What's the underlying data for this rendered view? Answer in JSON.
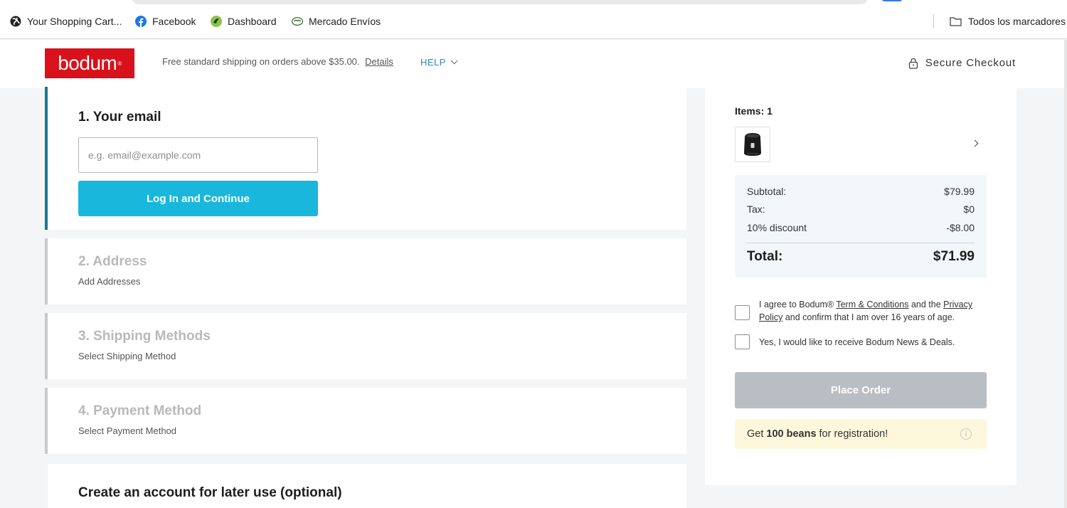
{
  "bookmarks": {
    "items": [
      {
        "label": "Your Shopping Cart...",
        "icon": "globe-icon"
      },
      {
        "label": "Facebook",
        "icon": "facebook-icon"
      },
      {
        "label": "Dashboard",
        "icon": "dashboard-icon"
      },
      {
        "label": "Mercado Envíos",
        "icon": "mercado-icon"
      }
    ],
    "all_bookmarks": "Todos los marcadores"
  },
  "header": {
    "logo": "bodum",
    "logo_mark": "®",
    "promo_text": "Free standard shipping on orders above $35.00.",
    "promo_link": "Details",
    "help_label": "HELP",
    "secure_label": "Secure Checkout"
  },
  "steps": {
    "email": {
      "title": "1. Your email",
      "placeholder": "e.g. email@example.com",
      "button": "Log In and Continue"
    },
    "address": {
      "title": "2. Address",
      "subtitle": "Add Addresses"
    },
    "shipping": {
      "title": "3. Shipping Methods",
      "subtitle": "Select Shipping Method"
    },
    "payment": {
      "title": "4. Payment Method",
      "subtitle": "Select Payment Method"
    },
    "create_account": {
      "title": "Create an account for later use (optional)"
    }
  },
  "summary": {
    "items_count": "Items: 1",
    "subtotal_label": "Subtotal:",
    "subtotal_value": "$79.99",
    "tax_label": "Tax:",
    "tax_value": "$0",
    "discount_label": "10% discount",
    "discount_value": "-$8.00",
    "total_label": "Total:",
    "total_value": "$71.99",
    "terms_prefix": "I agree to Bodum® ",
    "terms_link": "Term & Conditions",
    "terms_middle": " and the ",
    "privacy_link": "Privacy Policy",
    "terms_suffix": " and confirm that I am over 16 years of age.",
    "newsletter": "Yes, I would like to receive Bodum News & Deals.",
    "place_order": "Place Order",
    "beans_prefix": "Get",
    "beans_bold": "100 beans",
    "beans_suffix": "for registration!",
    "info_glyph": "i"
  },
  "colors": {
    "brand_red": "#d9111b",
    "accent_cyan": "#19b7dc",
    "active_step": "#1b7893",
    "disabled_button": "#b9bdc4"
  }
}
